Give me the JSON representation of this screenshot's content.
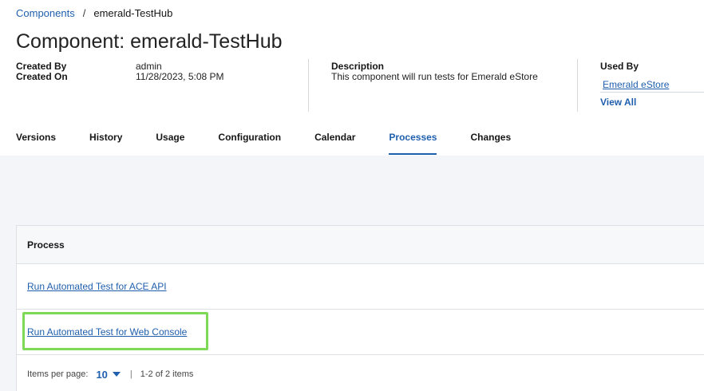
{
  "breadcrumb": {
    "root": "Components",
    "separator": "/",
    "current": "emerald-TestHub"
  },
  "page_title": "Component: emerald-TestHub",
  "meta": {
    "created_by_label": "Created By",
    "created_by_value": "admin",
    "created_on_label": "Created On",
    "created_on_value": "11/28/2023, 5:08 PM",
    "description_label": "Description",
    "description_value": "This component will run tests for Emerald eStore",
    "used_by_label": "Used By",
    "used_by_link": "Emerald eStore",
    "view_all": "View All"
  },
  "tabs": [
    "Versions",
    "History",
    "Usage",
    "Configuration",
    "Calendar",
    "Processes",
    "Changes"
  ],
  "active_tab": "Processes",
  "table": {
    "header": "Process",
    "rows": [
      "Run Automated Test for ACE API",
      "Run Automated Test for Web Console"
    ]
  },
  "pager": {
    "items_per_page_label": "Items per page:",
    "items_per_page_value": "10",
    "separator": "|",
    "range": "1-2 of 2 items"
  },
  "colors": {
    "link": "#1f5fad",
    "highlight": "#7ed957",
    "background": "#f3f5f8"
  },
  "icons": {
    "pager_dropdown": "caret-down-icon"
  }
}
